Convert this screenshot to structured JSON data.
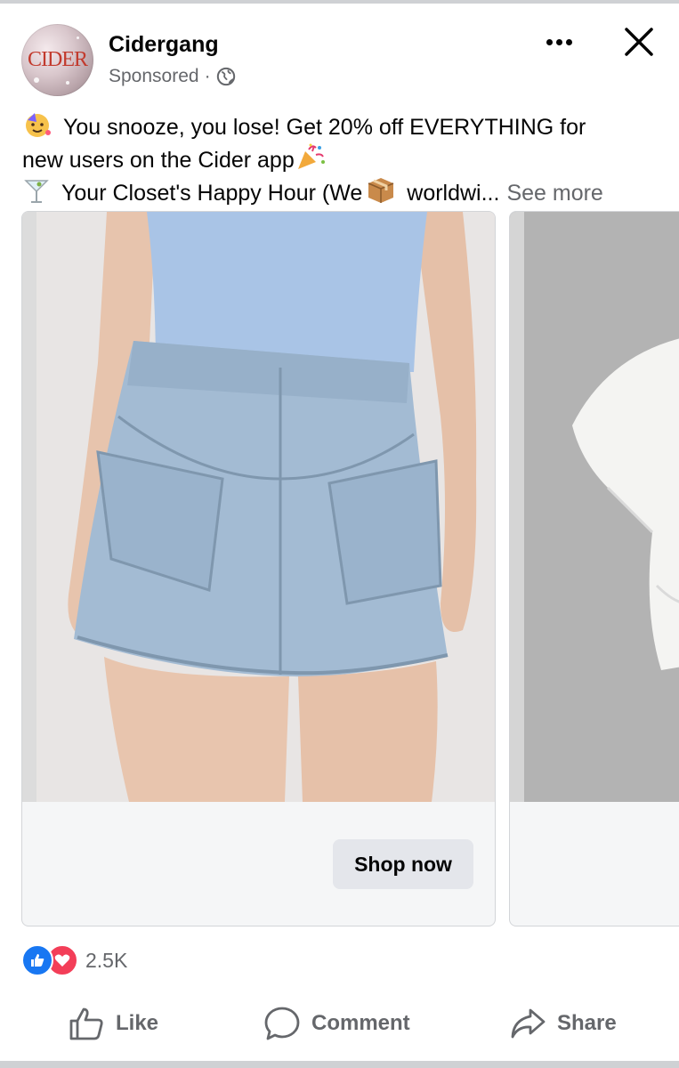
{
  "post": {
    "page_name": "Cidergang",
    "sponsored": "Sponsored",
    "separator": "·",
    "avatar_text": "CIDER",
    "text_line1": "You snooze, you lose! Get 20% off EVERYTHING for",
    "text_line2": "new users on the Cider app",
    "text_line3_a": "Your Closet's Happy Hour (We",
    "text_line3_b": "worldwi...",
    "see_more": "See more"
  },
  "carousel": {
    "cards": [
      {
        "image": "denim-mini-skirt-photo",
        "cta_label": "Shop now"
      },
      {
        "image": "white-top-photo"
      }
    ]
  },
  "engagement": {
    "reaction_count": "2.5K"
  },
  "actions": {
    "like": "Like",
    "comment": "Comment",
    "share": "Share"
  },
  "icons": [
    "more-icon",
    "close-icon",
    "globe-icon",
    "party-face-icon",
    "party-popper-icon",
    "cocktail-icon",
    "package-icon",
    "thumbs-up-icon",
    "heart-icon",
    "comment-icon",
    "share-icon"
  ],
  "colors": {
    "link_gray": "#65676b",
    "like_blue": "#1877f2",
    "love_red": "#f33e58",
    "button_gray": "#e4e6eb"
  }
}
